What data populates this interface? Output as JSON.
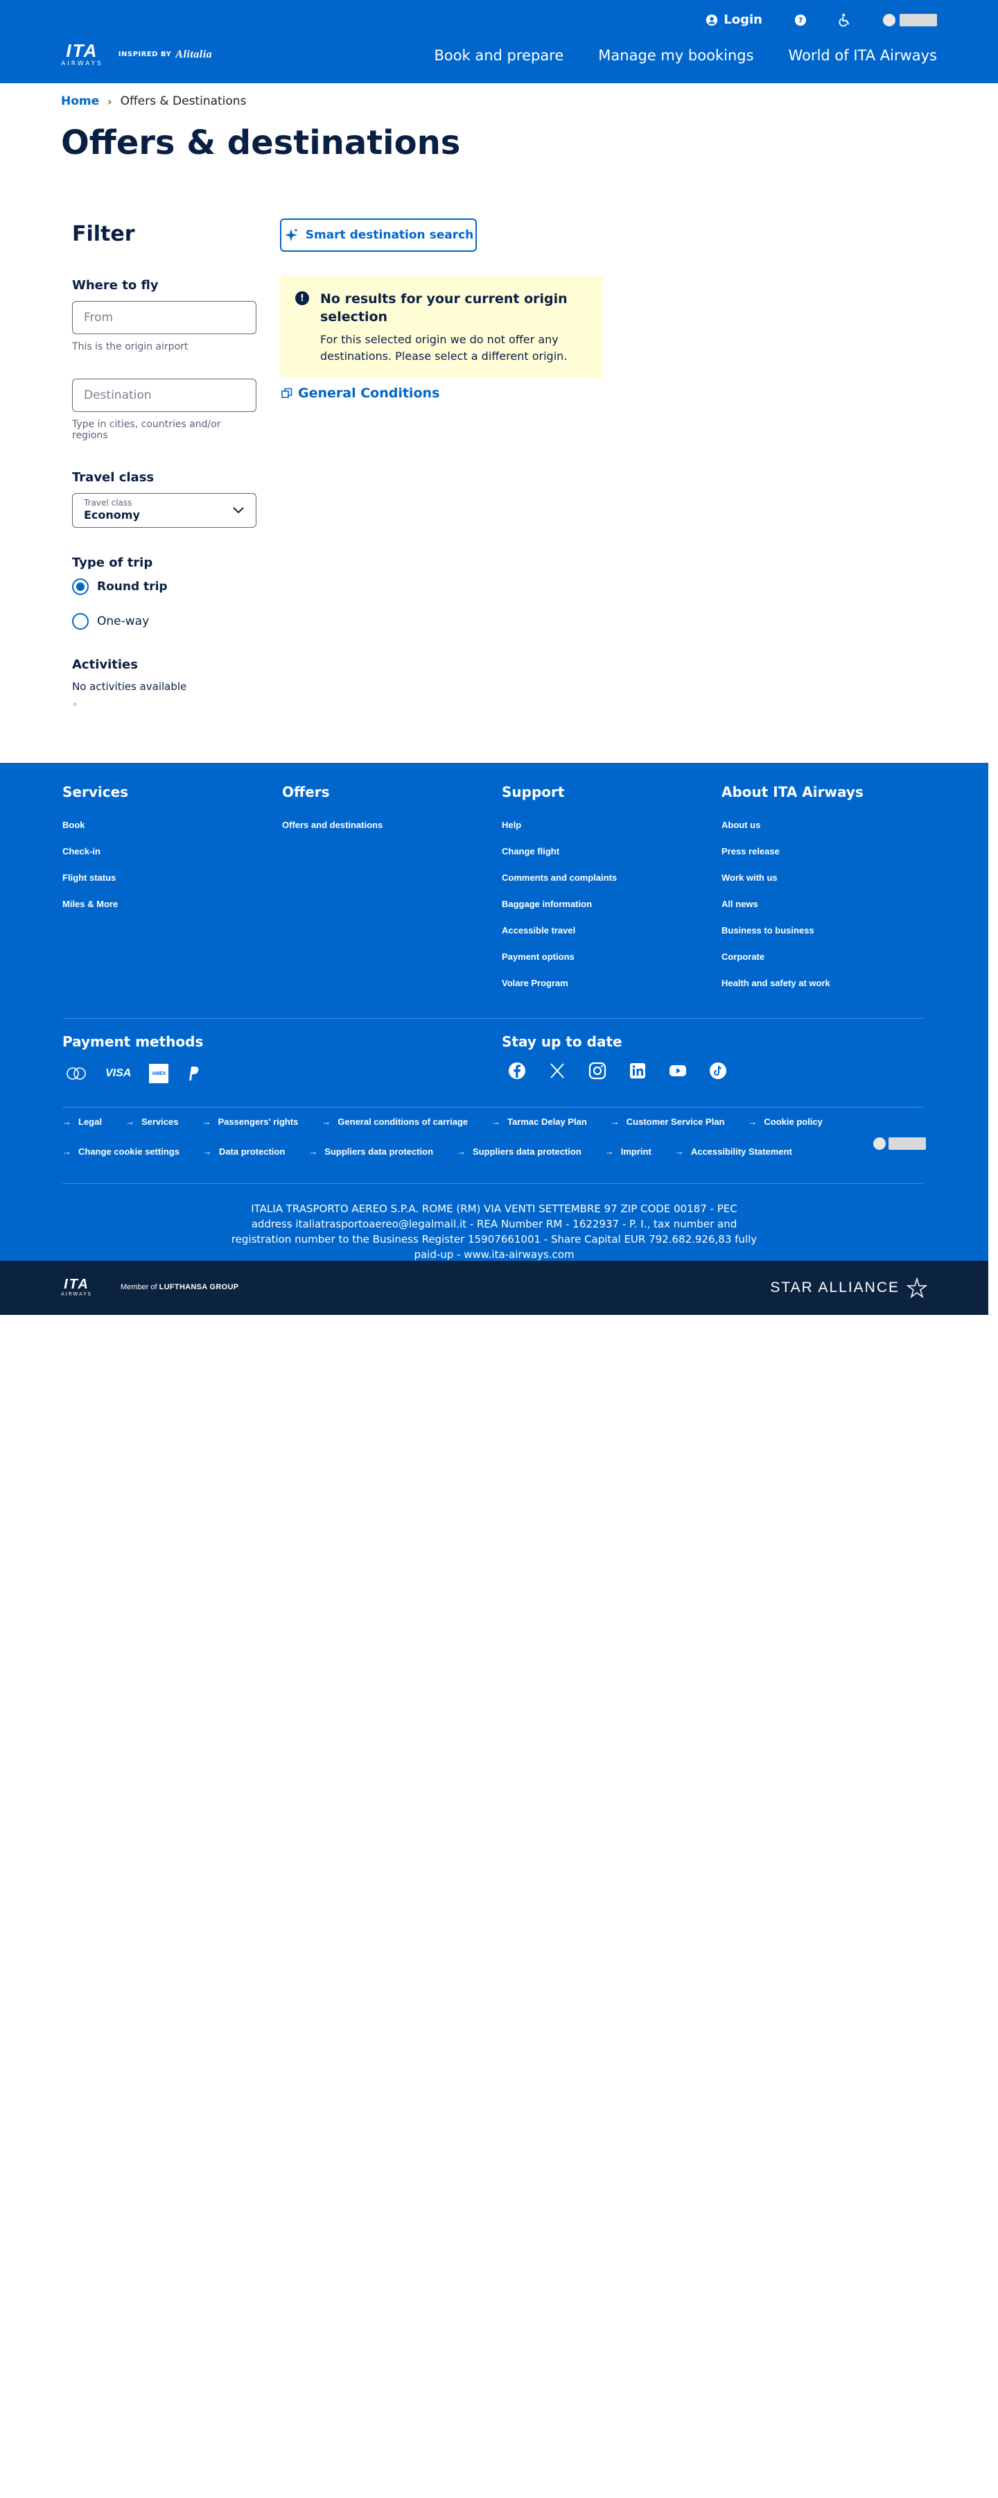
{
  "header": {
    "brand_name": "ITA",
    "brand_sub": "AIRWAYS",
    "inspired_by": "INSPIRED BY",
    "inspired_brand": "Alitalia",
    "login_label": "Login",
    "nav": [
      {
        "label": "Book and prepare"
      },
      {
        "label": "Manage my bookings"
      },
      {
        "label": "World of ITA Airways"
      }
    ]
  },
  "breadcrumb": {
    "home": "Home",
    "current": "Offers & Destinations"
  },
  "page_title": "Offers & destinations",
  "filter": {
    "title": "Filter",
    "where_to_fly": "Where to fly",
    "from_placeholder": "From",
    "from_hint": "This is the origin airport",
    "destination_placeholder": "Destination",
    "destination_hint": "Type in cities, countries and/or regions",
    "travel_class_title": "Travel class",
    "travel_class_label": "Travel class",
    "travel_class_value": "Economy",
    "trip_type_title": "Type of trip",
    "round_trip": "Round trip",
    "one_way": "One-way",
    "activities_title": "Activities",
    "activities_empty": "No activities available",
    "activities_marker": "◦"
  },
  "results": {
    "smart_search_label": "Smart destination search",
    "alert_title": "No results for your current origin selection",
    "alert_body": "For this selected origin we do not offer any destinations. Please select a different origin.",
    "general_conditions": "General Conditions"
  },
  "footer": {
    "columns": [
      {
        "title": "Services",
        "links": [
          "Book",
          "Check-in",
          "Flight status",
          "Miles & More"
        ]
      },
      {
        "title": "Offers",
        "links": [
          "Offers and destinations"
        ]
      },
      {
        "title": "Support",
        "links": [
          "Help",
          "Change flight",
          "Comments and complaints",
          "Baggage information",
          "Accessible travel",
          "Payment options",
          "Volare Program"
        ]
      },
      {
        "title": "About ITA Airways",
        "links": [
          "About us",
          "Press release",
          "Work with us",
          "All news",
          "Business to business",
          "Corporate",
          "Health and safety at work"
        ]
      }
    ],
    "payment_title": "Payment methods",
    "payment_visa": "VISA",
    "payment_amex": "AMEX",
    "stay_title": "Stay up to date",
    "legal_row1": [
      "Legal",
      "Services",
      "Passengers' rights",
      "General conditions of carriage",
      "Tarmac Delay Plan",
      "Customer Service Plan",
      "Cookie policy"
    ],
    "legal_row2": [
      "Change cookie settings",
      "Data protection",
      "Suppliers data protection",
      "Suppliers data protection",
      "Imprint",
      "Accessibility Statement"
    ],
    "company_info": "ITALIA TRASPORTO AEREO S.P.A. ROME (RM) VIA VENTI SETTEMBRE 97 ZIP CODE 00187 - PEC address italiatrasportoaereo@legalmail.it - REA Number RM - 1622937 - P. I., tax number and registration number to the Business Register 15907661001 - Share Capital EUR 792.682.926,83 fully paid-up - www.ita-airways.com"
  },
  "bottom_bar": {
    "brand_name": "ITA",
    "brand_sub": "AIRWAYS",
    "member_of": "Member of",
    "group": "LUFTHANSA GROUP",
    "alliance": "STAR ALLIANCE"
  },
  "colors": {
    "brand_blue": "#0066cc",
    "navy": "#0a1f44",
    "alert_bg": "#fffdd6",
    "bottom_bar": "#0c2340"
  }
}
